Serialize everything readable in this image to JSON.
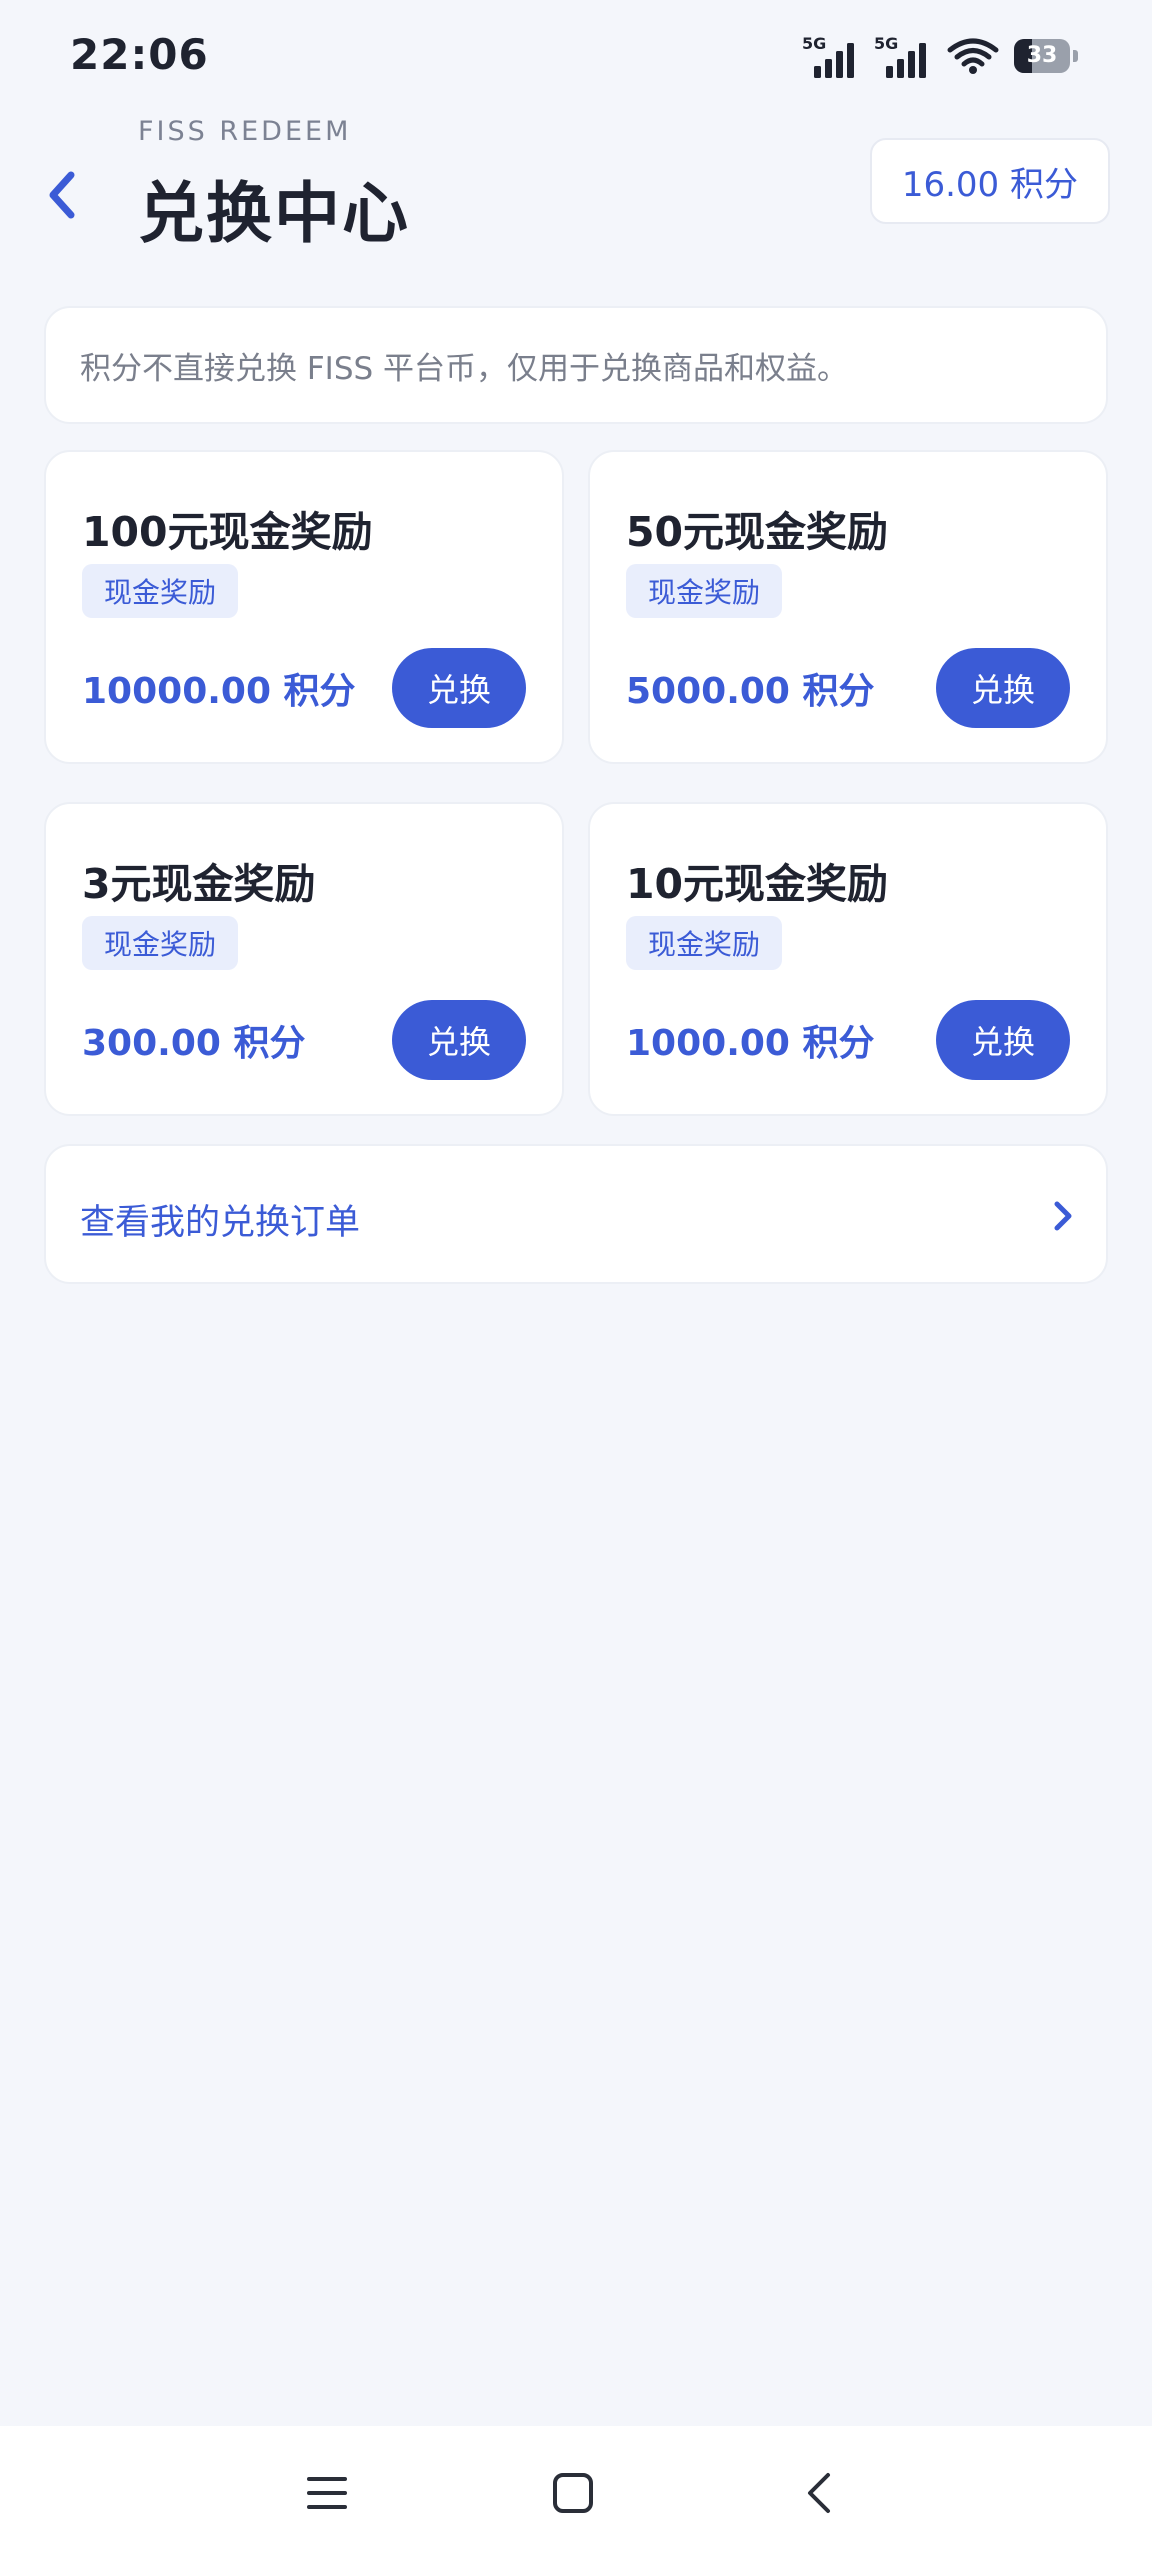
{
  "status_bar": {
    "time": "22:06",
    "signal_1_label": "5G",
    "signal_2_label": "5G",
    "battery_level": 33,
    "battery_text": "33"
  },
  "header": {
    "subtitle": "FISS REDEEM",
    "title": "兑换中心",
    "points_balance": "16.00 积分"
  },
  "notice": {
    "text": "积分不直接兑换 FISS 平台币，仅用于兑换商品和权益。"
  },
  "rewards": [
    {
      "title": "100元现金奖励",
      "tag": "现金奖励",
      "price": "10000.00 积分",
      "button": "兑换"
    },
    {
      "title": "50元现金奖励",
      "tag": "现金奖励",
      "price": "5000.00 积分",
      "button": "兑换"
    },
    {
      "title": "3元现金奖励",
      "tag": "现金奖励",
      "price": "300.00 积分",
      "button": "兑换"
    },
    {
      "title": "10元现金奖励",
      "tag": "现金奖励",
      "price": "1000.00 积分",
      "button": "兑换"
    }
  ],
  "orders_link": {
    "label": "查看我的兑换订单"
  },
  "colors": {
    "accent": "#3b5bd6",
    "background": "#f4f6fb",
    "tag_background": "#e9eefc"
  },
  "icons": {
    "back": "chevron-left-icon",
    "orders": "chevron-right-icon",
    "nav_menu": "menu-icon",
    "nav_home": "square-home-icon",
    "nav_back": "triangle-back-icon"
  }
}
